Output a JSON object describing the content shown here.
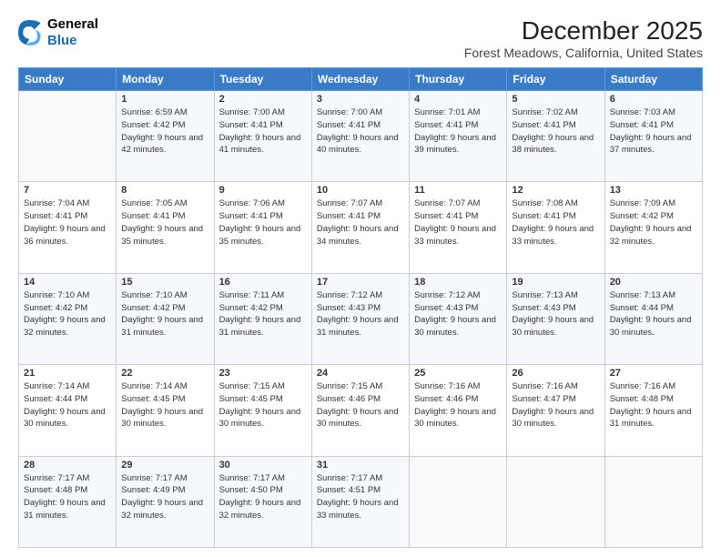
{
  "logo": {
    "line1": "General",
    "line2": "Blue"
  },
  "title": "December 2025",
  "subtitle": "Forest Meadows, California, United States",
  "weekdays": [
    "Sunday",
    "Monday",
    "Tuesday",
    "Wednesday",
    "Thursday",
    "Friday",
    "Saturday"
  ],
  "weeks": [
    [
      {
        "day": "",
        "sunrise": "",
        "sunset": "",
        "daylight": ""
      },
      {
        "day": "1",
        "sunrise": "Sunrise: 6:59 AM",
        "sunset": "Sunset: 4:42 PM",
        "daylight": "Daylight: 9 hours and 42 minutes."
      },
      {
        "day": "2",
        "sunrise": "Sunrise: 7:00 AM",
        "sunset": "Sunset: 4:41 PM",
        "daylight": "Daylight: 9 hours and 41 minutes."
      },
      {
        "day": "3",
        "sunrise": "Sunrise: 7:00 AM",
        "sunset": "Sunset: 4:41 PM",
        "daylight": "Daylight: 9 hours and 40 minutes."
      },
      {
        "day": "4",
        "sunrise": "Sunrise: 7:01 AM",
        "sunset": "Sunset: 4:41 PM",
        "daylight": "Daylight: 9 hours and 39 minutes."
      },
      {
        "day": "5",
        "sunrise": "Sunrise: 7:02 AM",
        "sunset": "Sunset: 4:41 PM",
        "daylight": "Daylight: 9 hours and 38 minutes."
      },
      {
        "day": "6",
        "sunrise": "Sunrise: 7:03 AM",
        "sunset": "Sunset: 4:41 PM",
        "daylight": "Daylight: 9 hours and 37 minutes."
      }
    ],
    [
      {
        "day": "7",
        "sunrise": "Sunrise: 7:04 AM",
        "sunset": "Sunset: 4:41 PM",
        "daylight": "Daylight: 9 hours and 36 minutes."
      },
      {
        "day": "8",
        "sunrise": "Sunrise: 7:05 AM",
        "sunset": "Sunset: 4:41 PM",
        "daylight": "Daylight: 9 hours and 35 minutes."
      },
      {
        "day": "9",
        "sunrise": "Sunrise: 7:06 AM",
        "sunset": "Sunset: 4:41 PM",
        "daylight": "Daylight: 9 hours and 35 minutes."
      },
      {
        "day": "10",
        "sunrise": "Sunrise: 7:07 AM",
        "sunset": "Sunset: 4:41 PM",
        "daylight": "Daylight: 9 hours and 34 minutes."
      },
      {
        "day": "11",
        "sunrise": "Sunrise: 7:07 AM",
        "sunset": "Sunset: 4:41 PM",
        "daylight": "Daylight: 9 hours and 33 minutes."
      },
      {
        "day": "12",
        "sunrise": "Sunrise: 7:08 AM",
        "sunset": "Sunset: 4:41 PM",
        "daylight": "Daylight: 9 hours and 33 minutes."
      },
      {
        "day": "13",
        "sunrise": "Sunrise: 7:09 AM",
        "sunset": "Sunset: 4:42 PM",
        "daylight": "Daylight: 9 hours and 32 minutes."
      }
    ],
    [
      {
        "day": "14",
        "sunrise": "Sunrise: 7:10 AM",
        "sunset": "Sunset: 4:42 PM",
        "daylight": "Daylight: 9 hours and 32 minutes."
      },
      {
        "day": "15",
        "sunrise": "Sunrise: 7:10 AM",
        "sunset": "Sunset: 4:42 PM",
        "daylight": "Daylight: 9 hours and 31 minutes."
      },
      {
        "day": "16",
        "sunrise": "Sunrise: 7:11 AM",
        "sunset": "Sunset: 4:42 PM",
        "daylight": "Daylight: 9 hours and 31 minutes."
      },
      {
        "day": "17",
        "sunrise": "Sunrise: 7:12 AM",
        "sunset": "Sunset: 4:43 PM",
        "daylight": "Daylight: 9 hours and 31 minutes."
      },
      {
        "day": "18",
        "sunrise": "Sunrise: 7:12 AM",
        "sunset": "Sunset: 4:43 PM",
        "daylight": "Daylight: 9 hours and 30 minutes."
      },
      {
        "day": "19",
        "sunrise": "Sunrise: 7:13 AM",
        "sunset": "Sunset: 4:43 PM",
        "daylight": "Daylight: 9 hours and 30 minutes."
      },
      {
        "day": "20",
        "sunrise": "Sunrise: 7:13 AM",
        "sunset": "Sunset: 4:44 PM",
        "daylight": "Daylight: 9 hours and 30 minutes."
      }
    ],
    [
      {
        "day": "21",
        "sunrise": "Sunrise: 7:14 AM",
        "sunset": "Sunset: 4:44 PM",
        "daylight": "Daylight: 9 hours and 30 minutes."
      },
      {
        "day": "22",
        "sunrise": "Sunrise: 7:14 AM",
        "sunset": "Sunset: 4:45 PM",
        "daylight": "Daylight: 9 hours and 30 minutes."
      },
      {
        "day": "23",
        "sunrise": "Sunrise: 7:15 AM",
        "sunset": "Sunset: 4:45 PM",
        "daylight": "Daylight: 9 hours and 30 minutes."
      },
      {
        "day": "24",
        "sunrise": "Sunrise: 7:15 AM",
        "sunset": "Sunset: 4:46 PM",
        "daylight": "Daylight: 9 hours and 30 minutes."
      },
      {
        "day": "25",
        "sunrise": "Sunrise: 7:16 AM",
        "sunset": "Sunset: 4:46 PM",
        "daylight": "Daylight: 9 hours and 30 minutes."
      },
      {
        "day": "26",
        "sunrise": "Sunrise: 7:16 AM",
        "sunset": "Sunset: 4:47 PM",
        "daylight": "Daylight: 9 hours and 30 minutes."
      },
      {
        "day": "27",
        "sunrise": "Sunrise: 7:16 AM",
        "sunset": "Sunset: 4:48 PM",
        "daylight": "Daylight: 9 hours and 31 minutes."
      }
    ],
    [
      {
        "day": "28",
        "sunrise": "Sunrise: 7:17 AM",
        "sunset": "Sunset: 4:48 PM",
        "daylight": "Daylight: 9 hours and 31 minutes."
      },
      {
        "day": "29",
        "sunrise": "Sunrise: 7:17 AM",
        "sunset": "Sunset: 4:49 PM",
        "daylight": "Daylight: 9 hours and 32 minutes."
      },
      {
        "day": "30",
        "sunrise": "Sunrise: 7:17 AM",
        "sunset": "Sunset: 4:50 PM",
        "daylight": "Daylight: 9 hours and 32 minutes."
      },
      {
        "day": "31",
        "sunrise": "Sunrise: 7:17 AM",
        "sunset": "Sunset: 4:51 PM",
        "daylight": "Daylight: 9 hours and 33 minutes."
      },
      {
        "day": "",
        "sunrise": "",
        "sunset": "",
        "daylight": ""
      },
      {
        "day": "",
        "sunrise": "",
        "sunset": "",
        "daylight": ""
      },
      {
        "day": "",
        "sunrise": "",
        "sunset": "",
        "daylight": ""
      }
    ]
  ]
}
